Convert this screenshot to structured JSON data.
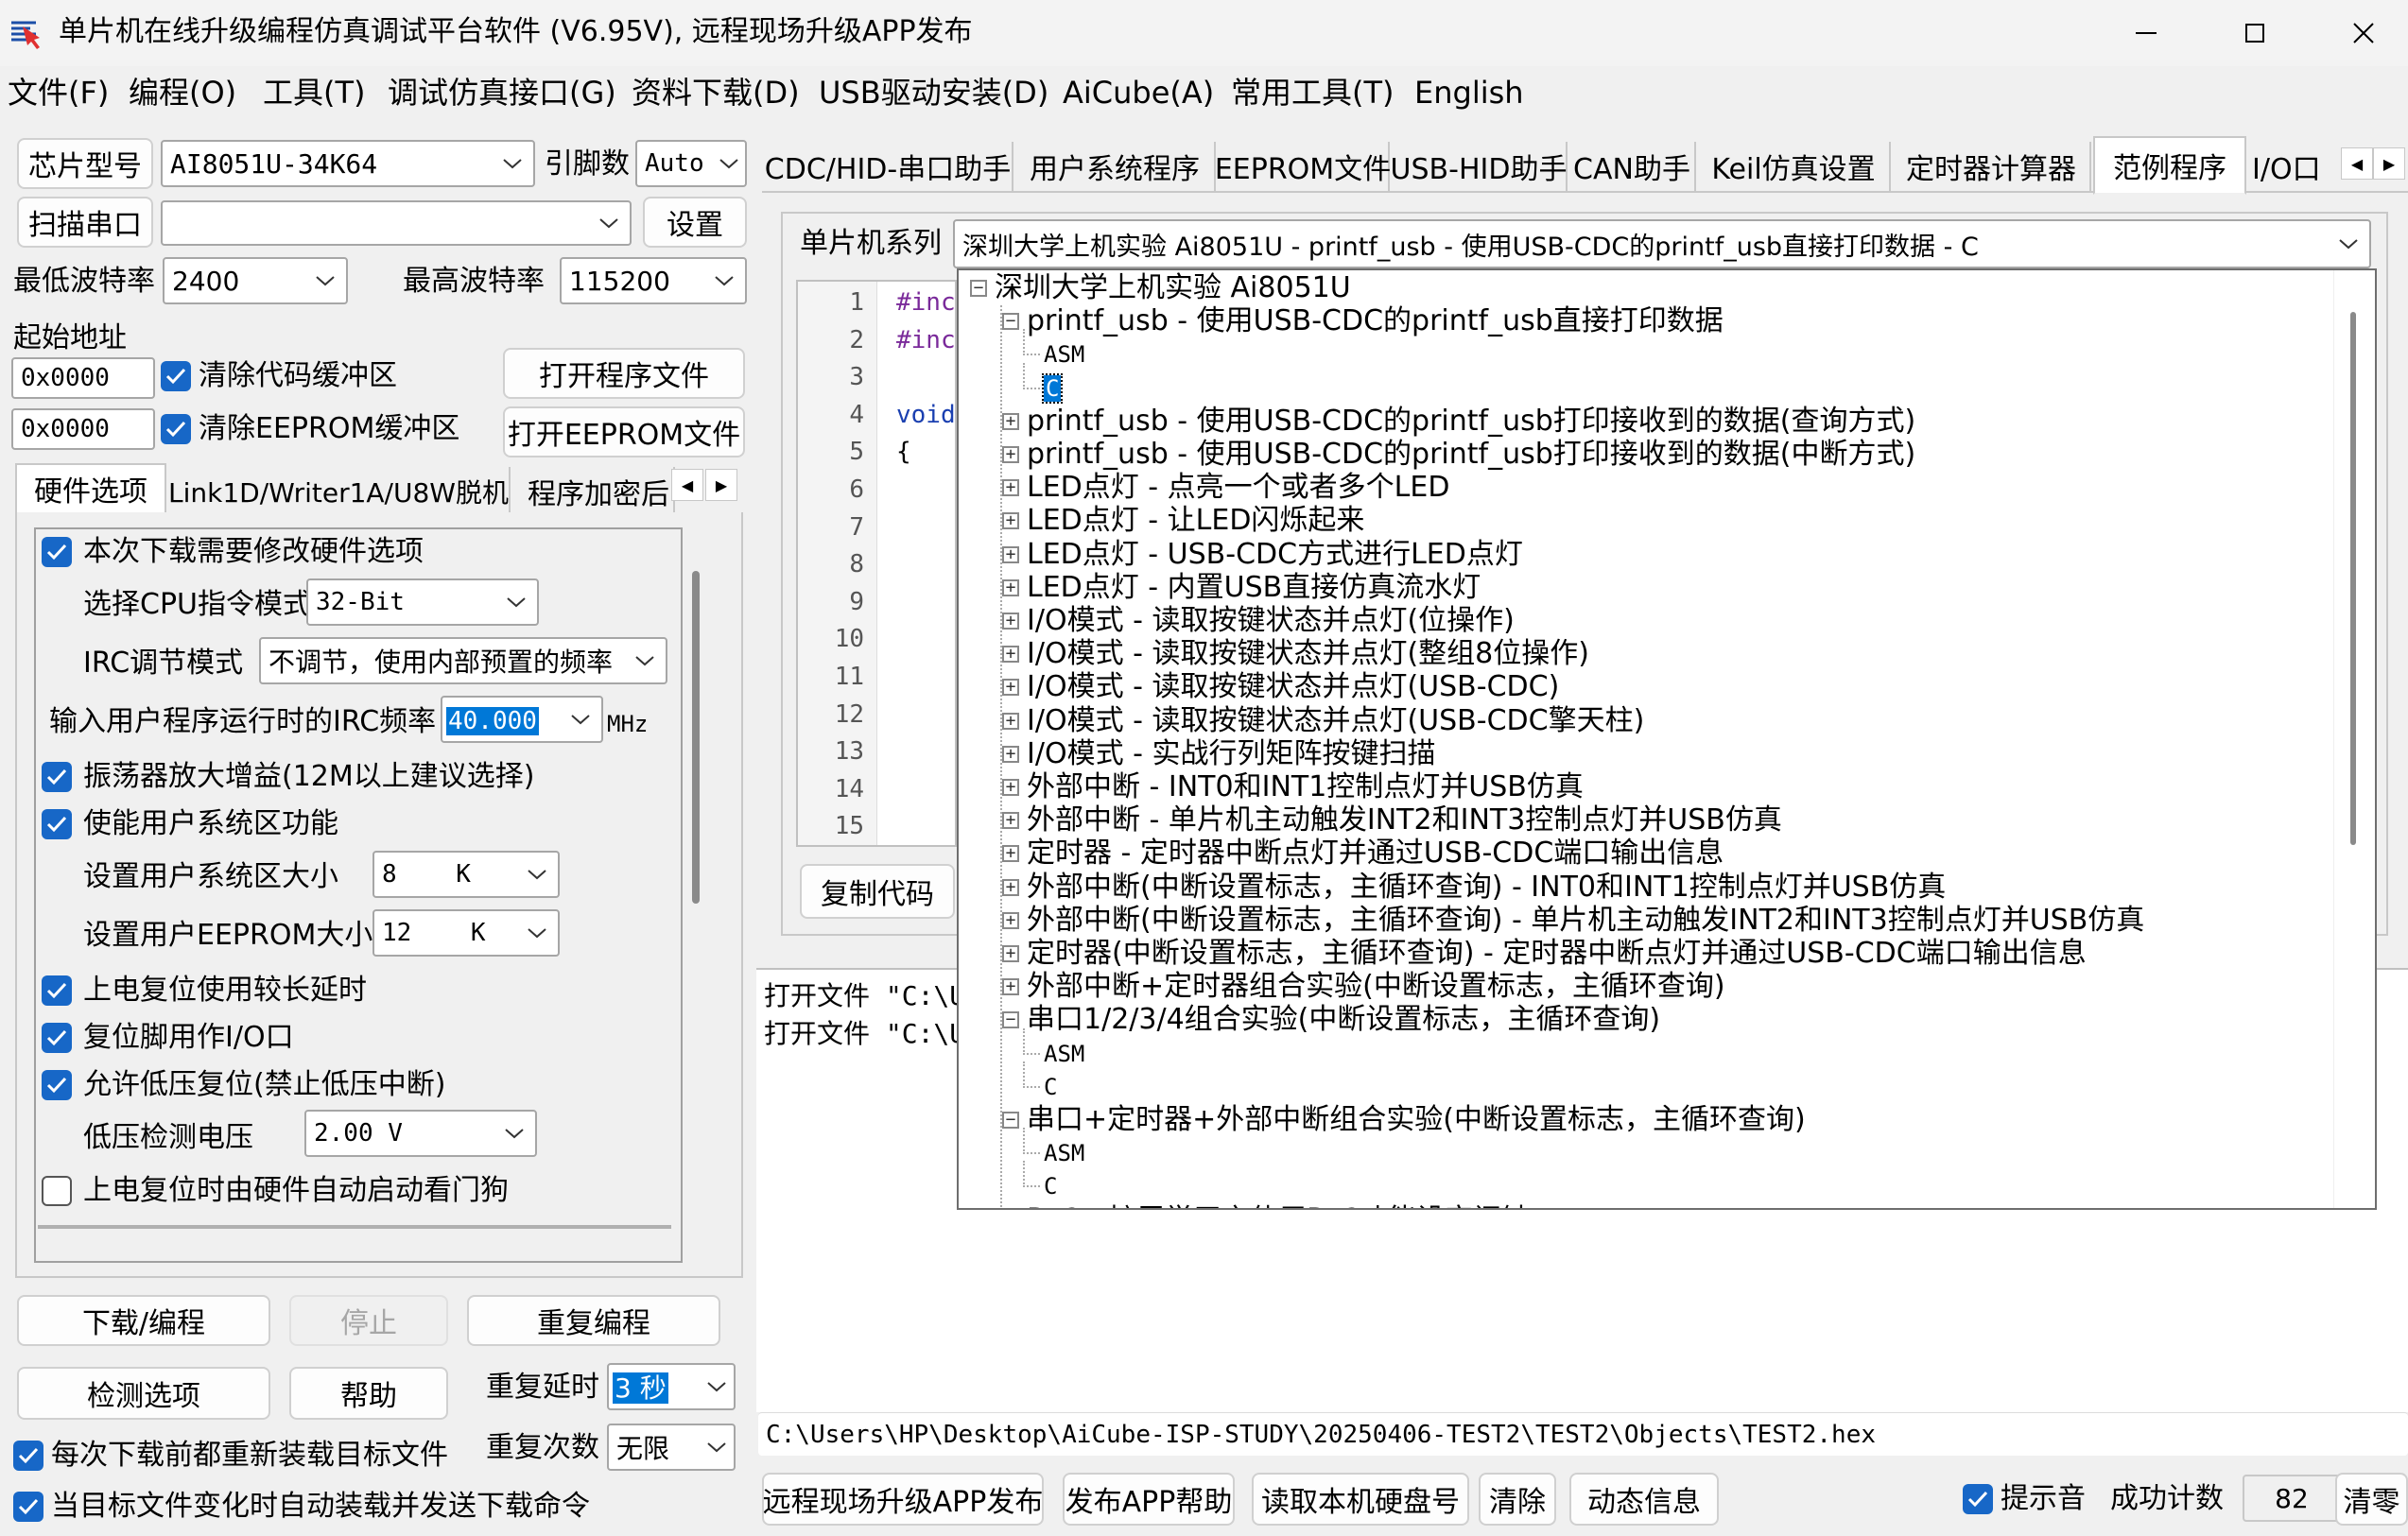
{
  "window": {
    "title": "单片机在线升级编程仿真调试平台软件 (V6.95V), 远程现场升级APP发布",
    "accent": "#0078d7",
    "checkbox_color": "#1767c7",
    "icon": "app-logo-icon"
  },
  "menu": [
    "文件(F)",
    "编程(O)",
    "工具(T)",
    "调试仿真接口(G)",
    "资料下载(D)",
    "USB驱动安装(D)",
    "AiCube(A)",
    "常用工具(T)",
    "English"
  ],
  "left": {
    "chip_type_btn": "芯片型号",
    "chip_type": "AI8051U-34K64",
    "pin_label": "引脚数",
    "pin_value": "Auto",
    "scan_port_btn": "扫描串口",
    "port_value": "",
    "settings_btn": "设置",
    "min_baud_label": "最低波特率",
    "min_baud": "2400",
    "max_baud_label": "最高波特率",
    "max_baud": "115200",
    "start_addr_label": "起始地址",
    "code_addr": "0x0000",
    "clear_code_label": "清除代码缓冲区",
    "open_prog_btn": "打开程序文件",
    "eeprom_addr": "0x0000",
    "clear_eeprom_label": "清除EEPROM缓冲区",
    "open_eeprom_btn": "打开EEPROM文件",
    "tabs": [
      "硬件选项",
      "Link1D/Writer1A/U8W脱机",
      "程序加密后"
    ],
    "options": {
      "modify_hw": "本次下载需要修改硬件选项",
      "cpu_mode_label": "选择CPU指令模式",
      "cpu_mode": "32-Bit",
      "irc_adjust_label": "IRC调节模式",
      "irc_adjust": "不调节，使用内部预置的频率",
      "irc_freq_label": "输入用户程序运行时的IRC频率",
      "irc_freq": "40.000",
      "irc_unit": "MHz",
      "osc_gain": "振荡器放大增益(12M以上建议选择)",
      "enable_sys": "使能用户系统区功能",
      "sys_size_label": "设置用户系统区大小",
      "sys_size": "8    K",
      "eeprom_size_label": "设置用户EEPROM大小",
      "eeprom_size": "12    K",
      "long_delay": "上电复位使用较长延时",
      "reset_io": "复位脚用作I/O口",
      "low_volt_reset": "允许低压复位(禁止低压中断)",
      "low_volt_label": "低压检测电压",
      "low_volt": "2.00 V",
      "watchdog": "上电复位时由硬件自动启动看门狗"
    },
    "download_btn": "下载/编程",
    "stop_btn": "停止",
    "repeat_btn": "重复编程",
    "check_btn": "检测选项",
    "help_btn": "帮助",
    "repeat_delay_label": "重复延时",
    "repeat_delay": "3 秒",
    "repeat_count_label": "重复次数",
    "repeat_count": "无限",
    "reload_each": "每次下载前都重新装载目标文件",
    "auto_reload": "当目标文件变化时自动装载并发送下载命令"
  },
  "right": {
    "tabs": [
      "CDC/HID-串口助手",
      "用户系统程序",
      "EEPROM文件",
      "USB-HID助手",
      "CAN助手",
      "Keil仿真设置",
      "定时器计算器",
      "范例程序",
      "I/O口"
    ],
    "series_label": "单片机系列",
    "series_value": "深圳大学上机实验 Ai8051U - printf_usb - 使用USB-CDC的printf_usb直接打印数据 - C",
    "line_numbers": [
      "1",
      "2",
      "3",
      "4",
      "5",
      "6",
      "7",
      "8",
      "9",
      "10",
      "11",
      "12",
      "13",
      "14",
      "15"
    ],
    "code_lines": [
      "#inc",
      "#inc",
      "",
      "void",
      "{",
      "",
      "",
      "",
      "",
      "",
      "",
      "",
      "",
      "",
      ""
    ],
    "copy_btn": "复制代码",
    "log": [
      "打开文件 \"C:\\U",
      "打开文件 \"C:\\U"
    ],
    "file_path": "C:\\Users\\HP\\Desktop\\AiCube-ISP-STUDY\\20250406-TEST2\\TEST2\\Objects\\TEST2.hex",
    "tree": [
      {
        "t": "深圳大学上机实验 Ai8051U",
        "lvl": 0,
        "exp": "-"
      },
      {
        "t": "printf_usb - 使用USB-CDC的printf_usb直接打印数据",
        "lvl": 1,
        "exp": "-"
      },
      {
        "t": "ASM",
        "lvl": 2,
        "exp": ""
      },
      {
        "t": "C",
        "lvl": 2,
        "exp": "",
        "sel": true
      },
      {
        "t": "printf_usb - 使用USB-CDC的printf_usb打印接收到的数据(查询方式)",
        "lvl": 1,
        "exp": "+"
      },
      {
        "t": "printf_usb - 使用USB-CDC的printf_usb打印接收到的数据(中断方式)",
        "lvl": 1,
        "exp": "+"
      },
      {
        "t": "LED点灯 - 点亮一个或者多个LED",
        "lvl": 1,
        "exp": "+"
      },
      {
        "t": "LED点灯 - 让LED闪烁起来",
        "lvl": 1,
        "exp": "+"
      },
      {
        "t": "LED点灯 - USB-CDC方式进行LED点灯",
        "lvl": 1,
        "exp": "+"
      },
      {
        "t": "LED点灯 - 内置USB直接仿真流水灯",
        "lvl": 1,
        "exp": "+"
      },
      {
        "t": "I/O模式 - 读取按键状态并点灯(位操作)",
        "lvl": 1,
        "exp": "+"
      },
      {
        "t": "I/O模式 - 读取按键状态并点灯(整组8位操作)",
        "lvl": 1,
        "exp": "+"
      },
      {
        "t": "I/O模式 - 读取按键状态并点灯(USB-CDC)",
        "lvl": 1,
        "exp": "+"
      },
      {
        "t": "I/O模式 - 读取按键状态并点灯(USB-CDC擎天柱)",
        "lvl": 1,
        "exp": "+"
      },
      {
        "t": "I/O模式 - 实战行列矩阵按键扫描",
        "lvl": 1,
        "exp": "+"
      },
      {
        "t": "外部中断 - INT0和INT1控制点灯并USB仿真",
        "lvl": 1,
        "exp": "+"
      },
      {
        "t": "外部中断 - 单片机主动触发INT2和INT3控制点灯并USB仿真",
        "lvl": 1,
        "exp": "+"
      },
      {
        "t": "定时器 - 定时器中断点灯并通过USB-CDC端口输出信息",
        "lvl": 1,
        "exp": "+"
      },
      {
        "t": "外部中断(中断设置标志，主循环查询) - INT0和INT1控制点灯并USB仿真",
        "lvl": 1,
        "exp": "+"
      },
      {
        "t": "外部中断(中断设置标志，主循环查询) - 单片机主动触发INT2和INT3控制点灯并USB仿真",
        "lvl": 1,
        "exp": "+"
      },
      {
        "t": "定时器(中断设置标志，主循环查询) - 定时器中断点灯并通过USB-CDC端口输出信息",
        "lvl": 1,
        "exp": "+"
      },
      {
        "t": "外部中断+定时器组合实验(中断设置标志，主循环查询)",
        "lvl": 1,
        "exp": "+"
      },
      {
        "t": "串口1/2/3/4组合实验(中断设置标志，主循环查询)",
        "lvl": 1,
        "exp": "-"
      },
      {
        "t": "ASM",
        "lvl": 2,
        "exp": ""
      },
      {
        "t": "C",
        "lvl": 2,
        "exp": ""
      },
      {
        "t": "串口+定时器+外部中断组合实验(中断设置标志，主循环查询)",
        "lvl": 1,
        "exp": "-"
      },
      {
        "t": "ASM",
        "lvl": 2,
        "exp": ""
      },
      {
        "t": "C",
        "lvl": 2,
        "exp": ""
      },
      {
        "t": "RTC - 扩展学习之使用RTC功能设定闹钟",
        "lvl": 1,
        "exp": "+"
      }
    ],
    "bottom": {
      "publish_btn": "远程现场升级APP发布",
      "publish_help_btn": "发布APP帮助",
      "read_disk_btn": "读取本机硬盘号",
      "clear_btn": "清除",
      "dynamic_btn": "动态信息",
      "beep_label": "提示音",
      "success_label": "成功计数",
      "success_count": "82",
      "reset_count_btn": "清零"
    }
  }
}
